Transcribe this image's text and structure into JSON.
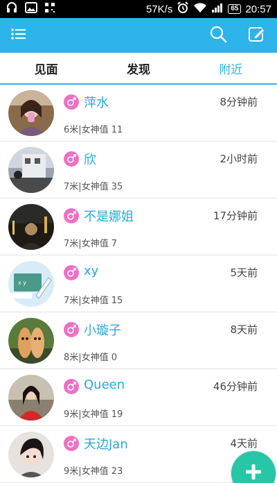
{
  "status_bar": {
    "speed": "57K/s",
    "battery": "65",
    "time": "20:57",
    "icons": [
      "headset-icon",
      "image-icon",
      "qr-icon",
      "alarm-icon",
      "wifi-icon",
      "signal-icon"
    ]
  },
  "appbar": {
    "icons": [
      "menu-icon",
      "search-icon",
      "compose-icon"
    ],
    "color": "#2db4ea"
  },
  "tabs": [
    {
      "label": "见面",
      "active": false
    },
    {
      "label": "发现",
      "active": false
    },
    {
      "label": "附近",
      "active": true
    }
  ],
  "users": [
    {
      "name": "萍水",
      "time": "8分钟前",
      "meta": "6米|女神值 11"
    },
    {
      "name": "欣",
      "time": "2小时前",
      "meta": "7米|女神值 35"
    },
    {
      "name": "不是娜姐",
      "time": "17分钟前",
      "meta": "7米|女神值 7"
    },
    {
      "name": "xy",
      "time": "5天前",
      "meta": "7米|女神值 15"
    },
    {
      "name": "小璇子",
      "time": "8天前",
      "meta": "8米|女神值 0"
    },
    {
      "name": "Queen",
      "time": "46分钟前",
      "meta": "9米|女神值 19"
    },
    {
      "name": "天边Jan",
      "time": "4天前",
      "meta": "9米|女神值 23"
    }
  ],
  "fab": {
    "icon": "plus-icon",
    "color": "#26c6a6"
  }
}
